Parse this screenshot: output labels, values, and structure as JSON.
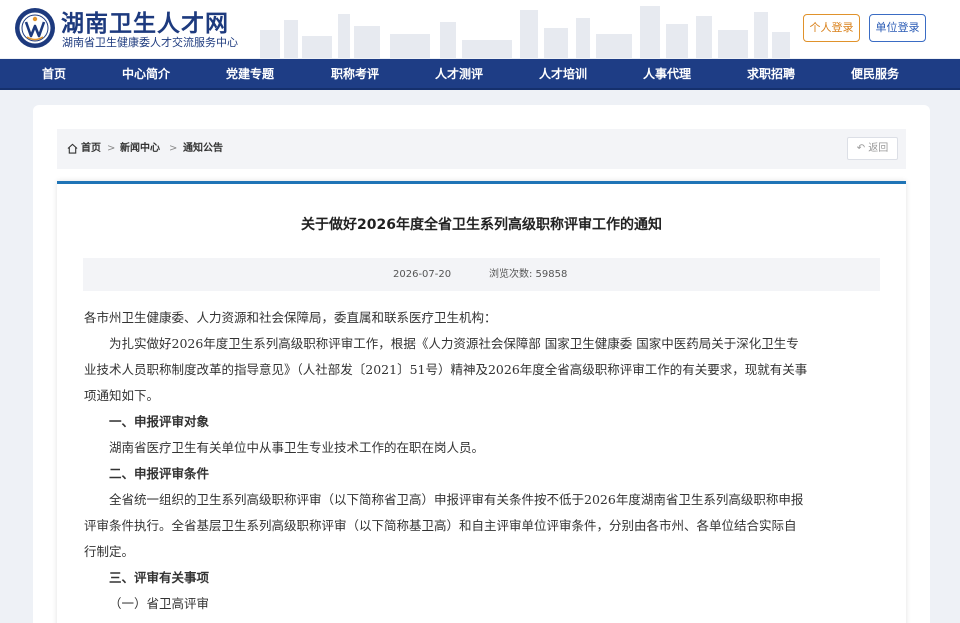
{
  "header": {
    "site_title": "湖南卫生人才网",
    "site_subtitle": "湖南省卫生健康委人才交流服务中心",
    "personal_login": "个人登录",
    "unit_login": "单位登录"
  },
  "nav": {
    "items": [
      {
        "label": "首页"
      },
      {
        "label": "中心简介"
      },
      {
        "label": "党建专题"
      },
      {
        "label": "职称考评"
      },
      {
        "label": "人才测评"
      },
      {
        "label": "人才培训"
      },
      {
        "label": "人事代理"
      },
      {
        "label": "求职招聘"
      },
      {
        "label": "便民服务"
      }
    ]
  },
  "breadcrumb": {
    "home": "首页",
    "news": "新闻中心",
    "notice": "通知公告",
    "sep": ">",
    "back": "返回"
  },
  "article": {
    "title": "关于做好2026年度全省卫生系列高级职称评审工作的通知",
    "date": "2026-07-20",
    "views": "浏览次数: 59858",
    "lines": [
      "各市州卫生健康委、人力资源和社会保障局，委直属和联系医疗卫生机构：",
      "为扎实做好2026年度卫生系列高级职称评审工作，根据《人力资源社会保障部 国家卫生健康委 国家中医药局关于深化卫生专",
      "业技术人员职称制度改革的指导意见》（人社部发〔2021〕51号）精神及2026年度全省高级职称评审工作的有关要求，现就有关事",
      "项通知如下。",
      "一、申报评审对象",
      "湖南省医疗卫生有关单位中从事卫生专业技术工作的在职在岗人员。",
      "二、申报评审条件",
      "全省统一组织的卫生系列高级职称评审（以下简称省卫高）申报评审有关条件按不低于2026年度湖南省卫生系列高级职称申报",
      "评审条件执行。全省基层卫生系列高级职称评审（以下简称基卫高）和自主评审单位评审条件，分别由各市州、各单位结合实际自",
      "行制定。",
      "三、评审有关事项",
      "（一）省卫高评审"
    ]
  },
  "colors": {
    "brand": "#1d3a7e",
    "nav_bg": "#1e3d85",
    "accent_orange": "#e0922b",
    "accent_blue": "#1f74b6"
  }
}
